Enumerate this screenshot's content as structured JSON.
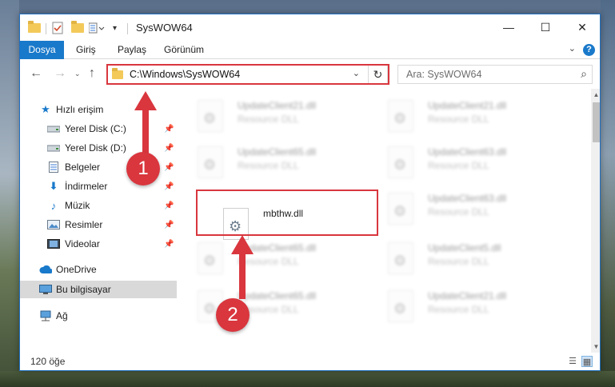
{
  "window": {
    "title": "SysWOW64",
    "controls": {
      "minimize": "—",
      "maximize": "☐",
      "close": "✕"
    }
  },
  "ribbon": {
    "tabs": [
      {
        "label": "Dosya",
        "active": true
      },
      {
        "label": "Giriş"
      },
      {
        "label": "Paylaş"
      },
      {
        "label": "Görünüm"
      }
    ],
    "help": "?"
  },
  "address": {
    "path": "C:\\Windows\\SysWOW64",
    "search_placeholder": "Ara: SysWOW64"
  },
  "nav": {
    "items": [
      {
        "label": "Hızlı erişim",
        "icon": "star-icon",
        "pinned": false
      },
      {
        "label": "Yerel Disk (C:)",
        "icon": "drive-icon",
        "pinned": true
      },
      {
        "label": "Yerel Disk (D:)",
        "icon": "drive-icon",
        "pinned": true
      },
      {
        "label": "Belgeler",
        "icon": "document-icon",
        "pinned": true
      },
      {
        "label": "İndirmeler",
        "icon": "download-icon",
        "pinned": true
      },
      {
        "label": "Müzik",
        "icon": "music-icon",
        "pinned": true
      },
      {
        "label": "Resimler",
        "icon": "picture-icon",
        "pinned": true
      },
      {
        "label": "Videolar",
        "icon": "video-icon",
        "pinned": true
      },
      {
        "label": "OneDrive",
        "icon": "cloud-icon",
        "pinned": false
      },
      {
        "label": "Bu bilgisayar",
        "icon": "computer-icon",
        "pinned": false,
        "selected": true
      },
      {
        "label": "Ağ",
        "icon": "network-icon",
        "pinned": false
      }
    ]
  },
  "files": {
    "highlighted": {
      "name": "mbthw.dll",
      "description": ""
    },
    "background": [
      {
        "name": "UpdateClient21.dll",
        "description": "Resource DLL"
      },
      {
        "name": "UpdateClient21.dll",
        "description": "Resource DLL"
      },
      {
        "name": "UpdateClient65.dll",
        "description": "Resource DLL"
      },
      {
        "name": "UpdateClient63.dll",
        "description": "Resource DLL"
      },
      {
        "name": "UpdateClient63.dll",
        "description": "Resource DLL"
      },
      {
        "name": "UpdateClient65.dll",
        "description": "Resource DLL"
      },
      {
        "name": "UpdateClient5.dll",
        "description": "Resource DLL"
      },
      {
        "name": "UpdateClient65.dll",
        "description": "Resource DLL"
      },
      {
        "name": "UpdateClient21.dll",
        "description": "Resource DLL"
      }
    ]
  },
  "status": {
    "item_count": "120 öğe"
  },
  "annotations": {
    "step1": "1",
    "step2": "2",
    "color": "#d9363e"
  }
}
